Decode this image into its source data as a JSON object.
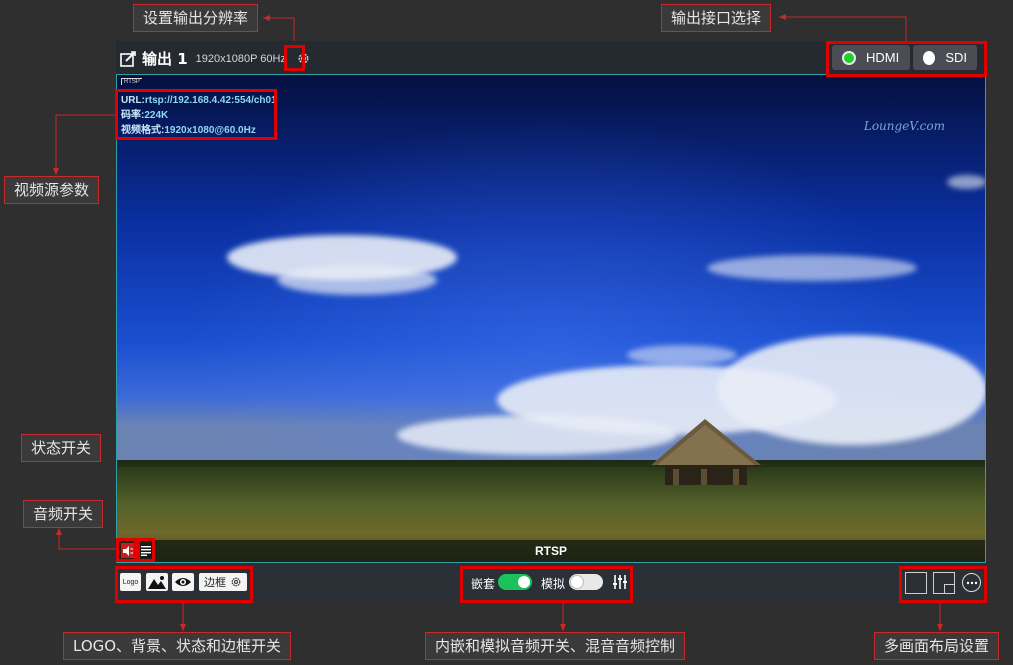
{
  "callouts": {
    "set_resolution": "设置输出分辨率",
    "output_port_select": "输出接口选择",
    "video_source_params": "视频源参数",
    "status_switch": "状态开关",
    "audio_switch": "音频开关",
    "logo_bg_switch": "LOGO、背景、状态和边框开关",
    "audio_mix_control": "内嵌和模拟音频开关、混音音频控制",
    "layout_settings": "多画面布局设置"
  },
  "header": {
    "title": "输出 1",
    "resolution": "1920x1080P 60Hz",
    "ports": [
      {
        "label": "HDMI",
        "selected": true
      },
      {
        "label": "SDI",
        "selected": false
      }
    ]
  },
  "video": {
    "protocol_tag": "RTSP",
    "url_label": "URL:",
    "url_value": "rtsp://192.168.4.42:554/ch01",
    "bitrate_label": "码率:",
    "bitrate_value": "224K",
    "format_label": "视频格式:",
    "format_value": "1920x1080@60.0Hz",
    "watermark": "LoungeV.com",
    "source_label": "RTSP"
  },
  "footer": {
    "logo_label": "Logo",
    "border_label": "边框",
    "embedded_label": "嵌套",
    "embedded_on": true,
    "analog_label": "模拟",
    "analog_on": false
  },
  "colors": {
    "highlight": "#e00000",
    "selected_port": "#1dd12a",
    "switch_on": "#19c25a"
  }
}
